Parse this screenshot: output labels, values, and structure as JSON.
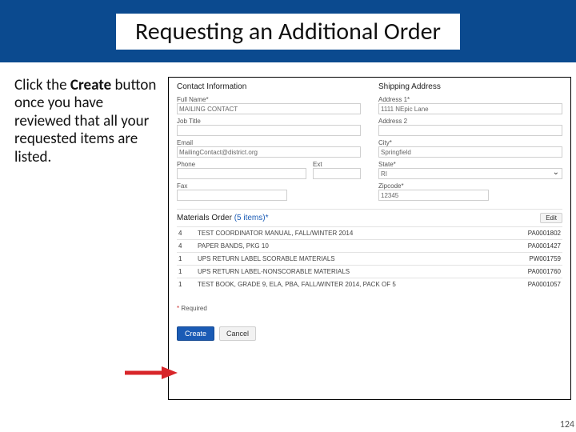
{
  "banner": {
    "title": "Requesting an Additional Order"
  },
  "instruction": {
    "pre": "Click the ",
    "bold": "Create",
    "post": " button once you have reviewed that all your requested items are listed."
  },
  "panel": {
    "contact": {
      "heading": "Contact Information",
      "fullName": {
        "label": "Full Name*",
        "value": "MAILING CONTACT"
      },
      "jobTitle": {
        "label": "Job Title",
        "value": ""
      },
      "email": {
        "label": "Email",
        "value": "MailingContact@district.org"
      },
      "phone": {
        "label": "Phone",
        "value": ""
      },
      "ext": {
        "label": "Ext",
        "value": ""
      },
      "fax": {
        "label": "Fax",
        "value": ""
      }
    },
    "shipping": {
      "heading": "Shipping Address",
      "addr1": {
        "label": "Address 1*",
        "value": "1111 NEpic Lane"
      },
      "addr2": {
        "label": "Address 2",
        "value": ""
      },
      "city": {
        "label": "City*",
        "value": "Springfield"
      },
      "state": {
        "label": "State*",
        "value": "RI"
      },
      "zip": {
        "label": "Zipcode*",
        "value": "12345"
      }
    },
    "materials": {
      "heading": "Materials Order",
      "count": "(5 items)*",
      "edit": "Edit",
      "rows": [
        {
          "qty": "4",
          "desc": "TEST COORDINATOR MANUAL, FALL/WINTER 2014",
          "sku": "PA0001802"
        },
        {
          "qty": "4",
          "desc": "PAPER BANDS, PKG 10",
          "sku": "PA0001427"
        },
        {
          "qty": "1",
          "desc": "UPS RETURN LABEL SCORABLE MATERIALS",
          "sku": "PW001759"
        },
        {
          "qty": "1",
          "desc": "UPS RETURN LABEL-NONSCORABLE MATERIALS",
          "sku": "PA0001760"
        },
        {
          "qty": "1",
          "desc": "TEST BOOK, GRADE 9, ELA, PBA, FALL/WINTER 2014, PACK OF 5",
          "sku": "PA0001057"
        }
      ]
    },
    "required": "Required",
    "buttons": {
      "create": "Create",
      "cancel": "Cancel"
    }
  },
  "pageNumber": "124"
}
